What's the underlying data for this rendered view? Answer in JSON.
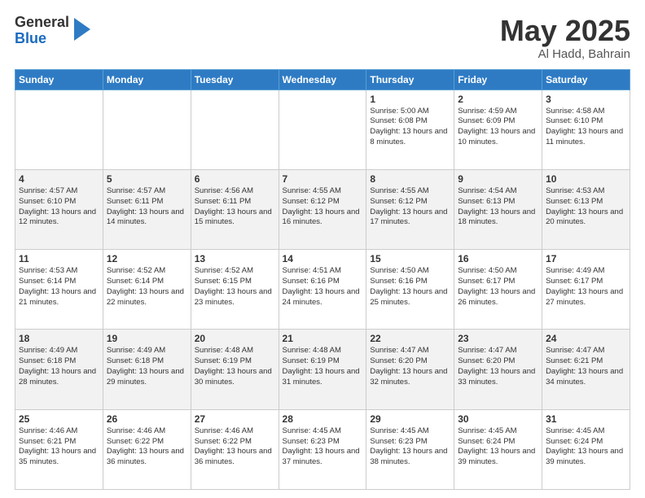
{
  "logo": {
    "general": "General",
    "blue": "Blue"
  },
  "title": {
    "month": "May 2025",
    "location": "Al Hadd, Bahrain"
  },
  "weekdays": [
    "Sunday",
    "Monday",
    "Tuesday",
    "Wednesday",
    "Thursday",
    "Friday",
    "Saturday"
  ],
  "weeks": [
    [
      {
        "day": "",
        "info": ""
      },
      {
        "day": "",
        "info": ""
      },
      {
        "day": "",
        "info": ""
      },
      {
        "day": "",
        "info": ""
      },
      {
        "day": "1",
        "info": "Sunrise: 5:00 AM\nSunset: 6:08 PM\nDaylight: 13 hours\nand 8 minutes."
      },
      {
        "day": "2",
        "info": "Sunrise: 4:59 AM\nSunset: 6:09 PM\nDaylight: 13 hours\nand 10 minutes."
      },
      {
        "day": "3",
        "info": "Sunrise: 4:58 AM\nSunset: 6:10 PM\nDaylight: 13 hours\nand 11 minutes."
      }
    ],
    [
      {
        "day": "4",
        "info": "Sunrise: 4:57 AM\nSunset: 6:10 PM\nDaylight: 13 hours\nand 12 minutes."
      },
      {
        "day": "5",
        "info": "Sunrise: 4:57 AM\nSunset: 6:11 PM\nDaylight: 13 hours\nand 14 minutes."
      },
      {
        "day": "6",
        "info": "Sunrise: 4:56 AM\nSunset: 6:11 PM\nDaylight: 13 hours\nand 15 minutes."
      },
      {
        "day": "7",
        "info": "Sunrise: 4:55 AM\nSunset: 6:12 PM\nDaylight: 13 hours\nand 16 minutes."
      },
      {
        "day": "8",
        "info": "Sunrise: 4:55 AM\nSunset: 6:12 PM\nDaylight: 13 hours\nand 17 minutes."
      },
      {
        "day": "9",
        "info": "Sunrise: 4:54 AM\nSunset: 6:13 PM\nDaylight: 13 hours\nand 18 minutes."
      },
      {
        "day": "10",
        "info": "Sunrise: 4:53 AM\nSunset: 6:13 PM\nDaylight: 13 hours\nand 20 minutes."
      }
    ],
    [
      {
        "day": "11",
        "info": "Sunrise: 4:53 AM\nSunset: 6:14 PM\nDaylight: 13 hours\nand 21 minutes."
      },
      {
        "day": "12",
        "info": "Sunrise: 4:52 AM\nSunset: 6:14 PM\nDaylight: 13 hours\nand 22 minutes."
      },
      {
        "day": "13",
        "info": "Sunrise: 4:52 AM\nSunset: 6:15 PM\nDaylight: 13 hours\nand 23 minutes."
      },
      {
        "day": "14",
        "info": "Sunrise: 4:51 AM\nSunset: 6:16 PM\nDaylight: 13 hours\nand 24 minutes."
      },
      {
        "day": "15",
        "info": "Sunrise: 4:50 AM\nSunset: 6:16 PM\nDaylight: 13 hours\nand 25 minutes."
      },
      {
        "day": "16",
        "info": "Sunrise: 4:50 AM\nSunset: 6:17 PM\nDaylight: 13 hours\nand 26 minutes."
      },
      {
        "day": "17",
        "info": "Sunrise: 4:49 AM\nSunset: 6:17 PM\nDaylight: 13 hours\nand 27 minutes."
      }
    ],
    [
      {
        "day": "18",
        "info": "Sunrise: 4:49 AM\nSunset: 6:18 PM\nDaylight: 13 hours\nand 28 minutes."
      },
      {
        "day": "19",
        "info": "Sunrise: 4:49 AM\nSunset: 6:18 PM\nDaylight: 13 hours\nand 29 minutes."
      },
      {
        "day": "20",
        "info": "Sunrise: 4:48 AM\nSunset: 6:19 PM\nDaylight: 13 hours\nand 30 minutes."
      },
      {
        "day": "21",
        "info": "Sunrise: 4:48 AM\nSunset: 6:19 PM\nDaylight: 13 hours\nand 31 minutes."
      },
      {
        "day": "22",
        "info": "Sunrise: 4:47 AM\nSunset: 6:20 PM\nDaylight: 13 hours\nand 32 minutes."
      },
      {
        "day": "23",
        "info": "Sunrise: 4:47 AM\nSunset: 6:20 PM\nDaylight: 13 hours\nand 33 minutes."
      },
      {
        "day": "24",
        "info": "Sunrise: 4:47 AM\nSunset: 6:21 PM\nDaylight: 13 hours\nand 34 minutes."
      }
    ],
    [
      {
        "day": "25",
        "info": "Sunrise: 4:46 AM\nSunset: 6:21 PM\nDaylight: 13 hours\nand 35 minutes."
      },
      {
        "day": "26",
        "info": "Sunrise: 4:46 AM\nSunset: 6:22 PM\nDaylight: 13 hours\nand 36 minutes."
      },
      {
        "day": "27",
        "info": "Sunrise: 4:46 AM\nSunset: 6:22 PM\nDaylight: 13 hours\nand 36 minutes."
      },
      {
        "day": "28",
        "info": "Sunrise: 4:45 AM\nSunset: 6:23 PM\nDaylight: 13 hours\nand 37 minutes."
      },
      {
        "day": "29",
        "info": "Sunrise: 4:45 AM\nSunset: 6:23 PM\nDaylight: 13 hours\nand 38 minutes."
      },
      {
        "day": "30",
        "info": "Sunrise: 4:45 AM\nSunset: 6:24 PM\nDaylight: 13 hours\nand 39 minutes."
      },
      {
        "day": "31",
        "info": "Sunrise: 4:45 AM\nSunset: 6:24 PM\nDaylight: 13 hours\nand 39 minutes."
      }
    ]
  ]
}
